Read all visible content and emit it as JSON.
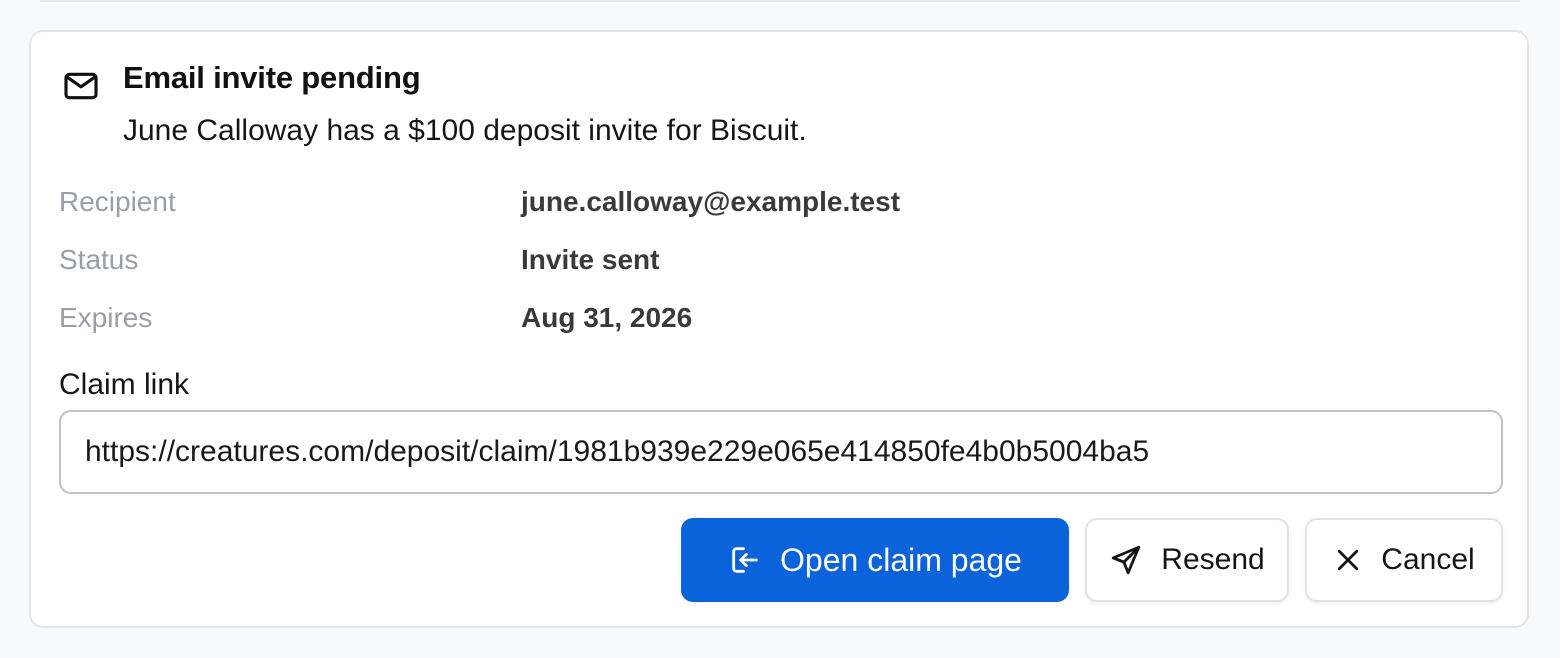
{
  "invite": {
    "title": "Email invite pending",
    "description": "June Calloway has a $100 deposit invite for Biscuit."
  },
  "details": [
    {
      "label": "Recipient",
      "value": "june.calloway@example.test"
    },
    {
      "label": "Status",
      "value": "Invite sent"
    },
    {
      "label": "Expires",
      "value": "Aug 31, 2026"
    }
  ],
  "claim": {
    "label": "Claim link",
    "url": "https://creatures.com/deposit/claim/1981b939e229e065e414850fe4b0b5004ba5"
  },
  "actions": {
    "open_label": "Open claim page",
    "resend_label": "Resend",
    "cancel_label": "Cancel"
  },
  "icons": {
    "header": "mail-icon",
    "open": "sign-in-icon",
    "resend": "send-icon",
    "cancel": "close-icon"
  },
  "colors": {
    "primary": "#0b63dc",
    "label": "#9a9ea5",
    "value": "#3a3a3a",
    "border": "#e2e4e8"
  }
}
